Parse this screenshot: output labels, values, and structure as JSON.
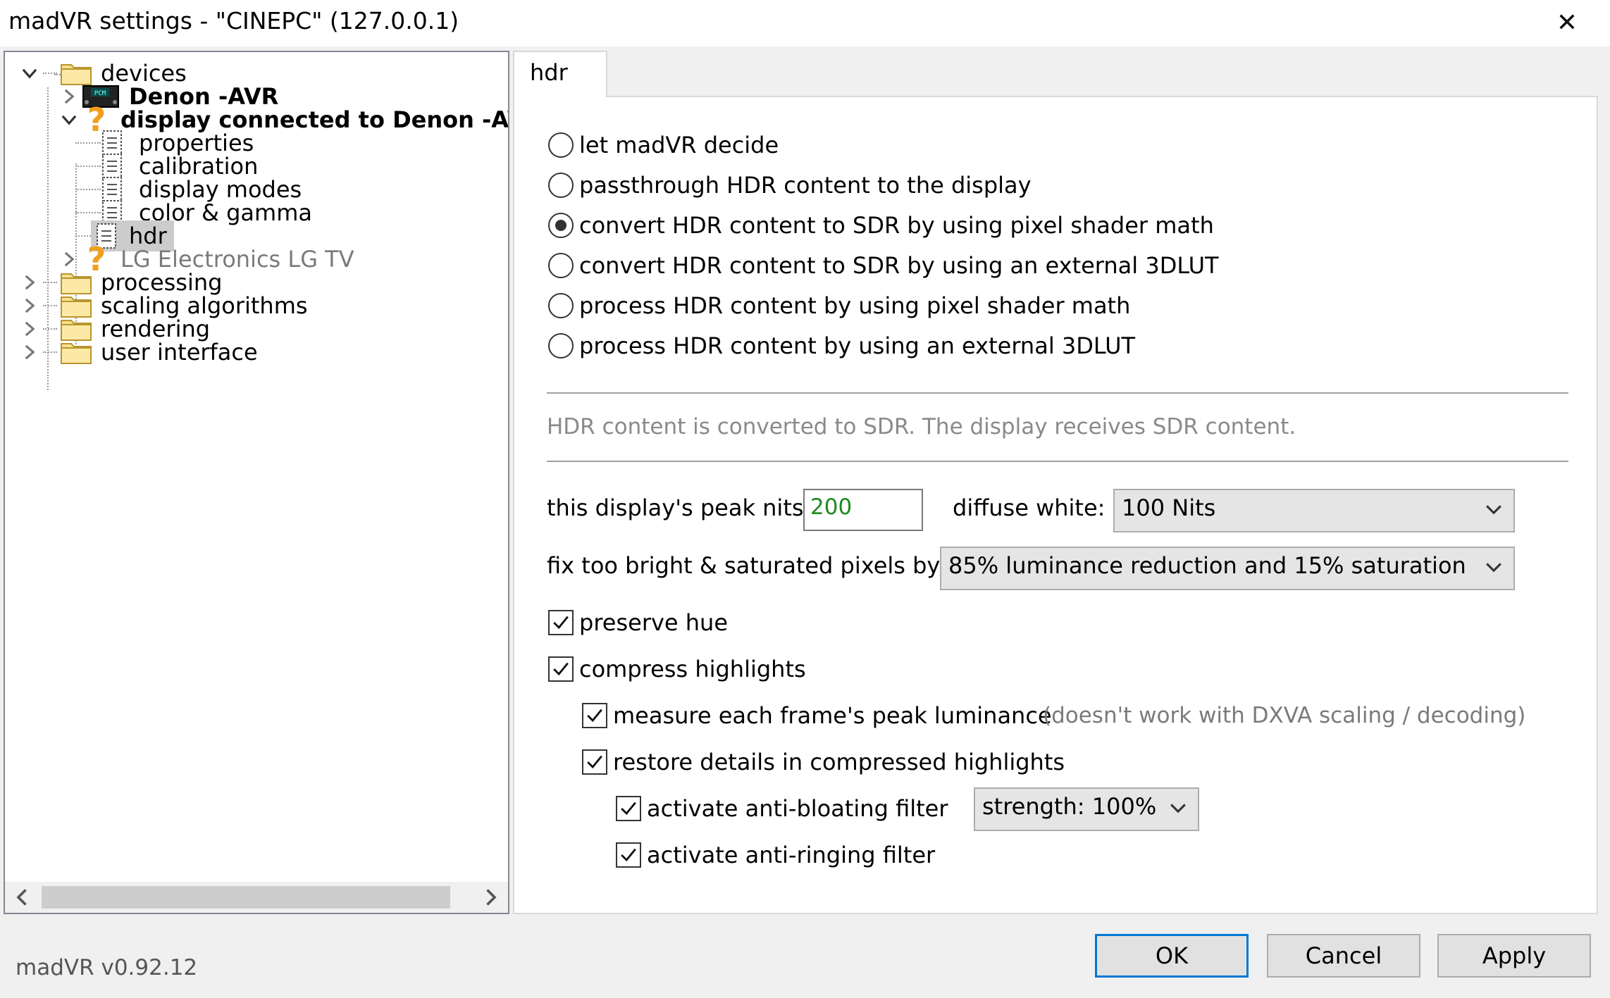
{
  "window": {
    "title": "madVR settings - \"CINEPC\" (127.0.0.1)",
    "close_icon": "close-icon"
  },
  "tree": {
    "items": [
      {
        "label": "devices",
        "icon": "folder-icon"
      },
      {
        "label": "Denon -AVR",
        "icon": "avr-device-icon"
      },
      {
        "label": "display connected to Denon -AV",
        "icon": "question-icon"
      },
      {
        "label": "properties",
        "icon": "page-icon"
      },
      {
        "label": "calibration",
        "icon": "page-icon"
      },
      {
        "label": "display modes",
        "icon": "page-icon"
      },
      {
        "label": "color & gamma",
        "icon": "page-icon"
      },
      {
        "label": "hdr",
        "icon": "page-icon"
      },
      {
        "label": "LG Electronics LG TV",
        "icon": "question-icon"
      },
      {
        "label": "processing",
        "icon": "folder-icon"
      },
      {
        "label": "scaling algorithms",
        "icon": "folder-icon"
      },
      {
        "label": "rendering",
        "icon": "folder-icon"
      },
      {
        "label": "user interface",
        "icon": "folder-icon"
      }
    ]
  },
  "tab": {
    "label": "hdr"
  },
  "hdr_modes": {
    "options": [
      {
        "label": "let madVR decide",
        "checked": false
      },
      {
        "label": "passthrough HDR content to the display",
        "checked": false
      },
      {
        "label": "convert HDR content to SDR by using pixel shader math",
        "checked": true
      },
      {
        "label": "convert HDR content to SDR by using an external 3DLUT",
        "checked": false
      },
      {
        "label": "process HDR content by using pixel shader math",
        "checked": false
      },
      {
        "label": "process HDR content by using an external 3DLUT",
        "checked": false
      }
    ]
  },
  "status_message": "HDR content is converted to SDR. The display receives SDR content.",
  "peak_nits": {
    "label": "this display's peak nits:",
    "value": "200"
  },
  "diffuse_white": {
    "label": "diffuse white:",
    "value": "100 Nits"
  },
  "fix_pixels": {
    "label": "fix too bright & saturated pixels by:",
    "value": "85% luminance reduction and 15% saturation"
  },
  "checks": {
    "preserve_hue": {
      "label": "preserve hue",
      "checked": true
    },
    "compress_highlights": {
      "label": "compress highlights",
      "checked": true
    },
    "measure_peak": {
      "label": "measure each frame's peak luminance",
      "checked": true,
      "note": "(doesn't work with DXVA scaling / decoding)"
    },
    "restore_details": {
      "label": "restore details in compressed highlights",
      "checked": true
    },
    "anti_bloating": {
      "label": "activate anti-bloating filter",
      "checked": true,
      "strength": "strength: 100%"
    },
    "anti_ringing": {
      "label": "activate anti-ringing filter",
      "checked": true
    }
  },
  "footer": {
    "version": "madVR v0.92.12",
    "ok": "OK",
    "cancel": "Cancel",
    "apply": "Apply"
  }
}
